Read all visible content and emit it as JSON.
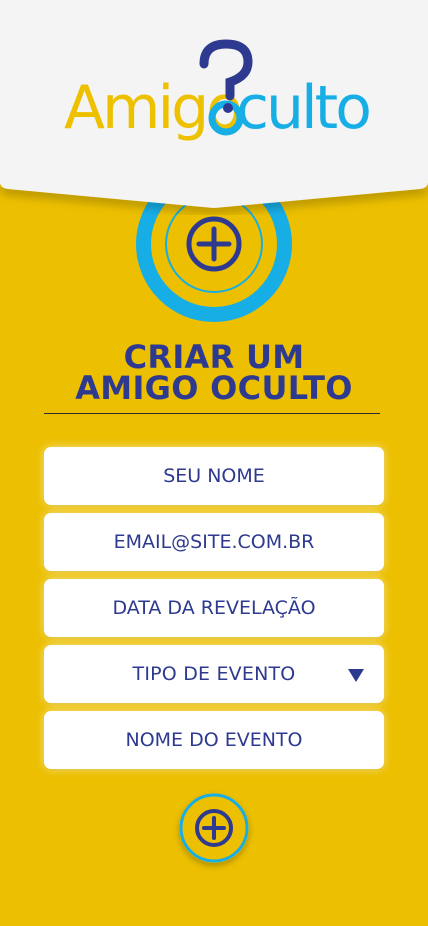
{
  "logo": {
    "text_left": "Amigo",
    "text_right": "culto",
    "question_mark": "?",
    "colors": {
      "yellow": "#edc100",
      "blue": "#17aee6",
      "navy": "#2e3a8f"
    }
  },
  "hero": {
    "icon": "plus-circle-icon"
  },
  "title": {
    "line1": "CRIAR UM",
    "line2": "AMIGO OCULTO"
  },
  "form": {
    "name": {
      "placeholder": "SEU NOME"
    },
    "email": {
      "placeholder": "EMAIL@SITE.COM.BR"
    },
    "date": {
      "placeholder": "DATA DA REVELAÇÃO"
    },
    "event_type": {
      "selected": "TIPO DE EVENTO",
      "icon": "triangle-down-icon"
    },
    "event_name": {
      "placeholder": "NOME DO EVENTO"
    }
  },
  "submit": {
    "icon": "plus-circle-icon"
  },
  "colors": {
    "background": "#ecbf00",
    "header": "#f4f4f4",
    "accent_blue": "#17aee6",
    "text_navy": "#2e3a8f"
  }
}
